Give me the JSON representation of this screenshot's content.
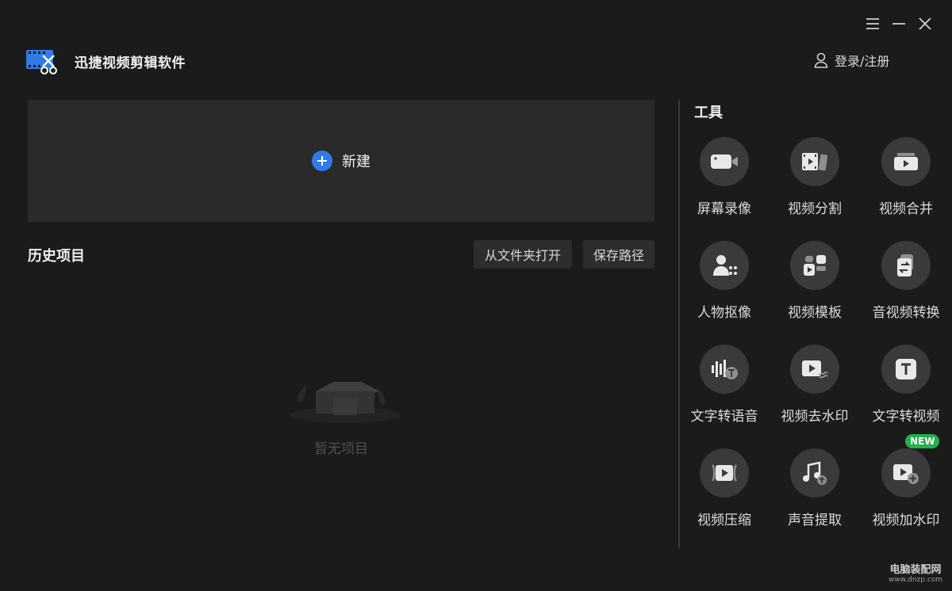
{
  "app": {
    "title": "迅捷视频剪辑软件"
  },
  "header": {
    "login_label": "登录/注册"
  },
  "main": {
    "new_label": "新建",
    "history_title": "历史项目",
    "open_folder_label": "从文件夹打开",
    "save_path_label": "保存路径",
    "empty_label": "暂无项目"
  },
  "tools": {
    "title": "工具",
    "items": [
      {
        "label": "屏幕录像",
        "icon": "camera-icon"
      },
      {
        "label": "视频分割",
        "icon": "film-split-icon"
      },
      {
        "label": "视频合并",
        "icon": "video-merge-icon"
      },
      {
        "label": "人物抠像",
        "icon": "person-cutout-icon"
      },
      {
        "label": "视频模板",
        "icon": "template-icon"
      },
      {
        "label": "音视频转换",
        "icon": "convert-icon"
      },
      {
        "label": "文字转语音",
        "icon": "text-to-speech-icon"
      },
      {
        "label": "视频去水印",
        "icon": "remove-watermark-icon"
      },
      {
        "label": "文字转视频",
        "icon": "text-to-video-icon"
      },
      {
        "label": "视频压缩",
        "icon": "compress-icon"
      },
      {
        "label": "声音提取",
        "icon": "audio-extract-icon"
      },
      {
        "label": "视频加水印",
        "icon": "add-watermark-icon"
      }
    ],
    "new_badge": "NEW"
  },
  "watermark": {
    "name": "电脑装配网",
    "url": "www.dnzp.com"
  },
  "colors": {
    "accent": "#2f7bea",
    "badge": "#22b14c",
    "background": "#1b1b1b"
  }
}
